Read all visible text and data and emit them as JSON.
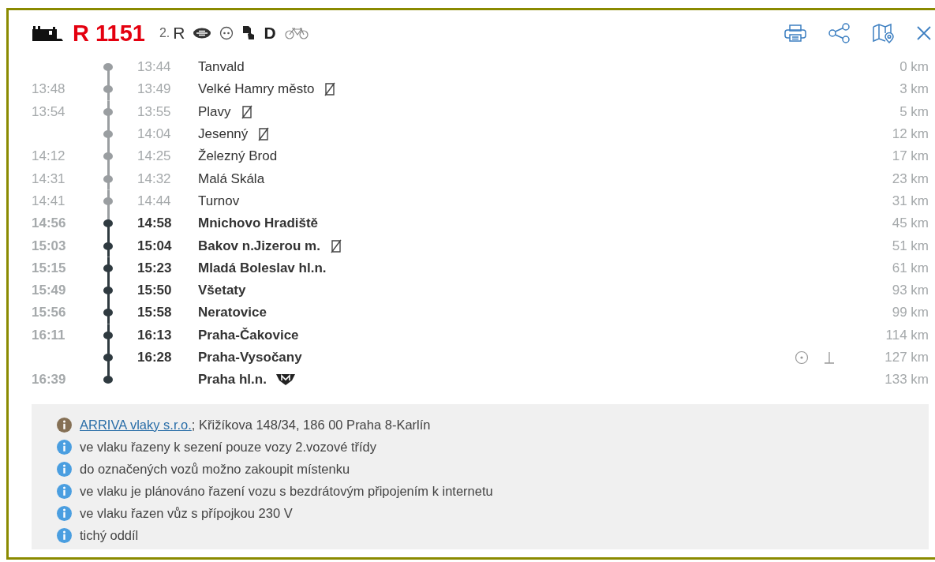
{
  "train": {
    "number": "R 1151",
    "services": [
      {
        "kind": "small-text",
        "text": "2."
      },
      {
        "kind": "text",
        "text": "R"
      },
      {
        "kind": "wifi"
      },
      {
        "kind": "socket"
      },
      {
        "kind": "ticket"
      },
      {
        "kind": "bold-text",
        "text": "D"
      },
      {
        "kind": "bike"
      }
    ]
  },
  "actions": [
    {
      "kind": "print"
    },
    {
      "kind": "share"
    },
    {
      "kind": "map"
    },
    {
      "kind": "close"
    }
  ],
  "stops": [
    {
      "departure": "13:44",
      "name": "Tanvald",
      "request_stop": false,
      "metro": false,
      "side_marks": false,
      "distance": "0 km",
      "passed": true
    },
    {
      "arrival": "13:48",
      "departure": "13:49",
      "name": "Velké Hamry město",
      "request_stop": true,
      "metro": false,
      "side_marks": false,
      "distance": "3 km",
      "passed": true
    },
    {
      "arrival": "13:54",
      "departure": "13:55",
      "name": "Plavy",
      "request_stop": true,
      "metro": false,
      "side_marks": false,
      "distance": "5 km",
      "passed": true
    },
    {
      "departure": "14:04",
      "name": "Jesenný",
      "request_stop": true,
      "metro": false,
      "side_marks": false,
      "distance": "12 km",
      "passed": true
    },
    {
      "arrival": "14:12",
      "departure": "14:25",
      "name": "Železný Brod",
      "request_stop": false,
      "metro": false,
      "side_marks": false,
      "distance": "17 km",
      "passed": true
    },
    {
      "arrival": "14:31",
      "departure": "14:32",
      "name": "Malá Skála",
      "request_stop": false,
      "metro": false,
      "side_marks": false,
      "distance": "23 km",
      "passed": true
    },
    {
      "arrival": "14:41",
      "departure": "14:44",
      "name": "Turnov",
      "request_stop": false,
      "metro": false,
      "side_marks": false,
      "distance": "31 km",
      "passed": true
    },
    {
      "arrival": "14:56",
      "departure": "14:58",
      "name": "Mnichovo Hradiště",
      "request_stop": false,
      "metro": false,
      "side_marks": false,
      "distance": "45 km",
      "passed": false
    },
    {
      "arrival": "15:03",
      "departure": "15:04",
      "name": "Bakov n.Jizerou m.",
      "request_stop": true,
      "metro": false,
      "side_marks": false,
      "distance": "51 km",
      "passed": false
    },
    {
      "arrival": "15:15",
      "departure": "15:23",
      "name": "Mladá Boleslav hl.n.",
      "request_stop": false,
      "metro": false,
      "side_marks": false,
      "distance": "61 km",
      "passed": false
    },
    {
      "arrival": "15:49",
      "departure": "15:50",
      "name": "Všetaty",
      "request_stop": false,
      "metro": false,
      "side_marks": false,
      "distance": "93 km",
      "passed": false
    },
    {
      "arrival": "15:56",
      "departure": "15:58",
      "name": "Neratovice",
      "request_stop": false,
      "metro": false,
      "side_marks": false,
      "distance": "99 km",
      "passed": false
    },
    {
      "arrival": "16:11",
      "departure": "16:13",
      "name": "Praha-Čakovice",
      "request_stop": false,
      "metro": false,
      "side_marks": false,
      "distance": "114 km",
      "passed": false
    },
    {
      "departure": "16:28",
      "name": "Praha-Vysočany",
      "request_stop": false,
      "metro": false,
      "side_marks": true,
      "distance": "127 km",
      "passed": false
    },
    {
      "arrival": "16:39",
      "name": "Praha hl.n.",
      "request_stop": false,
      "metro": true,
      "side_marks": false,
      "distance": "133 km",
      "passed": false
    }
  ],
  "notes": [
    {
      "link": "ARRIVA vlaky s.r.o.",
      "text": "; Křižíkova 148/34, 186 00 Praha 8-Karlín",
      "color": "#857055"
    },
    {
      "text": "ve vlaku řazeny k sezení pouze vozy 2.vozové třídy",
      "color": "#4a9ee0"
    },
    {
      "text": "do označených vozů možno zakoupit místenku",
      "color": "#4a9ee0"
    },
    {
      "text": "ve vlaku je plánováno řazení vozu s bezdrátovým připojením k internetu",
      "color": "#4a9ee0"
    },
    {
      "text": "ve vlaku řazen vůz s přípojkou 230 V",
      "color": "#4a9ee0"
    },
    {
      "text": "tichý oddíl",
      "color": "#4a9ee0"
    }
  ]
}
